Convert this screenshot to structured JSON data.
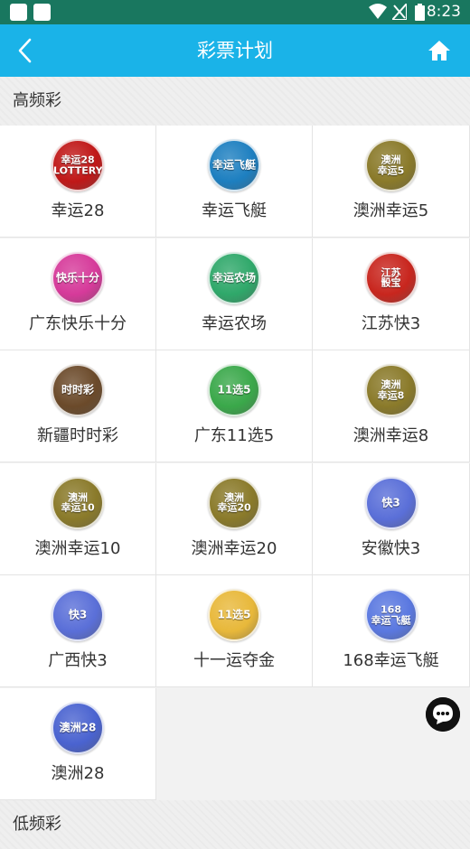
{
  "status": {
    "time": "8:23"
  },
  "header": {
    "title": "彩票计划"
  },
  "sections": {
    "high": "高频彩",
    "low": "低频彩"
  },
  "lotteries": [
    {
      "label": "幸运28",
      "icon_text": "幸运28\nLOTTERY",
      "icon": "lucky28-icon",
      "color": "#c01818"
    },
    {
      "label": "幸运飞艇",
      "icon_text": "幸运飞艇",
      "icon": "lucky-boat-icon",
      "color": "#1d7fc0"
    },
    {
      "label": "澳洲幸运5",
      "icon_text": "澳洲\n幸运5",
      "icon": "aus-lucky5-icon",
      "color": "#8a7a2a"
    },
    {
      "label": "广东快乐十分",
      "icon_text": "快乐十分",
      "icon": "gd-happy10-icon",
      "color": "#d63a9a"
    },
    {
      "label": "幸运农场",
      "icon_text": "幸运农场",
      "icon": "lucky-farm-icon",
      "color": "#2fa86a"
    },
    {
      "label": "江苏快3",
      "icon_text": "江苏\n骰宝",
      "icon": "js-k3-icon",
      "color": "#c8261e"
    },
    {
      "label": "新疆时时彩",
      "icon_text": "时时彩",
      "icon": "xj-ssc-icon",
      "color": "#6b4a2a"
    },
    {
      "label": "广东11选5",
      "icon_text": "11选5",
      "icon": "gd-11x5-icon",
      "color": "#3aa84a"
    },
    {
      "label": "澳洲幸运8",
      "icon_text": "澳洲\n幸运8",
      "icon": "aus-lucky8-icon",
      "color": "#8a7a2a"
    },
    {
      "label": "澳洲幸运10",
      "icon_text": "澳洲\n幸运10",
      "icon": "aus-lucky10-icon",
      "color": "#8a7a2a"
    },
    {
      "label": "澳洲幸运20",
      "icon_text": "澳洲\n幸运20",
      "icon": "aus-lucky20-icon",
      "color": "#8a7a2a"
    },
    {
      "label": "安徽快3",
      "icon_text": "快3",
      "icon": "ah-k3-icon",
      "color": "#5a6fd8"
    },
    {
      "label": "广西快3",
      "icon_text": "快3",
      "icon": "gx-k3-icon",
      "color": "#5a6fd8"
    },
    {
      "label": "十一运夺金",
      "icon_text": "11选5",
      "icon": "sd-11yunduojin-icon",
      "color": "#e8b83a"
    },
    {
      "label": "168幸运飞艇",
      "icon_text": "168\n幸运飞艇",
      "icon": "lucky-boat-168-icon",
      "color": "#5a78e0"
    },
    {
      "label": "澳洲28",
      "icon_text": "澳洲28",
      "icon": "aus28-icon",
      "color": "#4a63d0"
    }
  ]
}
